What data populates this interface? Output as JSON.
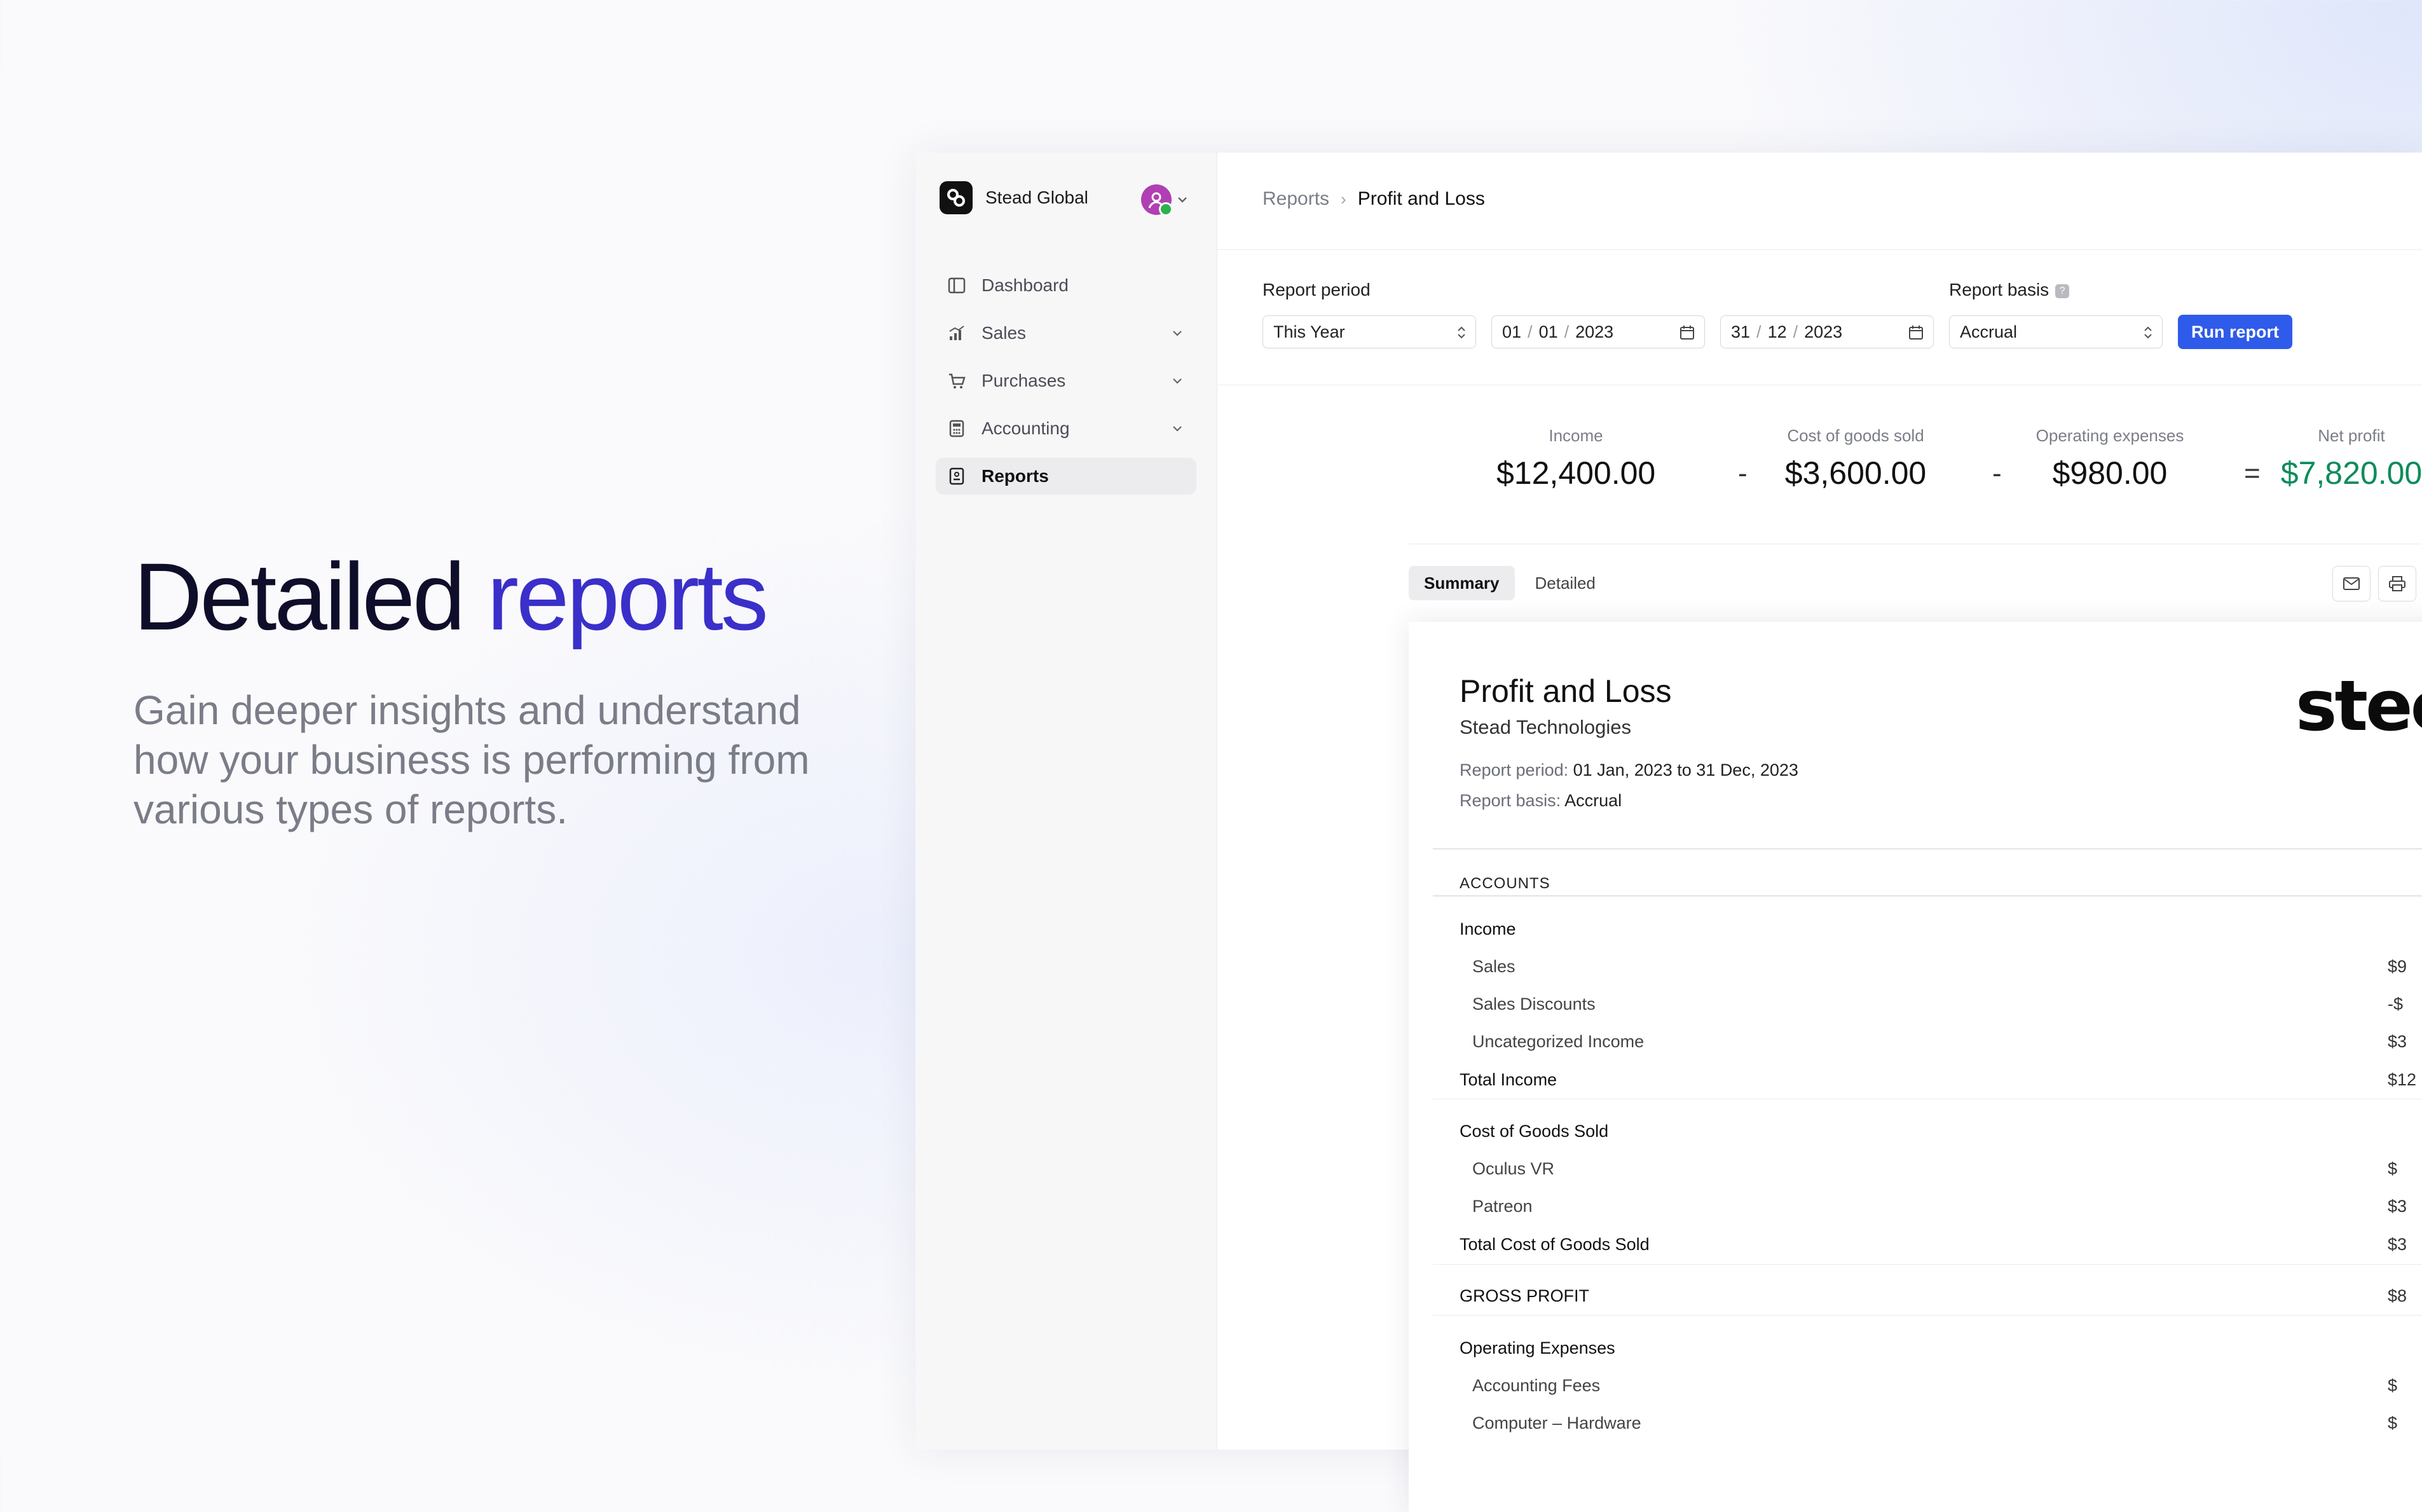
{
  "hero": {
    "title_a": "Detailed",
    "title_b": "reports",
    "subtitle": "Gain deeper insights and understand how your business is performing from various types of reports."
  },
  "org": {
    "name": "Stead Global"
  },
  "nav": [
    {
      "label": "Dashboard",
      "icon": "dashboard-icon"
    },
    {
      "label": "Sales",
      "icon": "sales-chart-icon",
      "expandable": true
    },
    {
      "label": "Purchases",
      "icon": "cart-icon",
      "expandable": true
    },
    {
      "label": "Accounting",
      "icon": "calculator-icon",
      "expandable": true
    },
    {
      "label": "Reports",
      "icon": "report-icon",
      "active": true
    }
  ],
  "breadcrumb": {
    "parent": "Reports",
    "current": "Profit and Loss"
  },
  "filters": {
    "period_label": "Report period",
    "period_value": "This Year",
    "from": {
      "dd": "01",
      "mm": "01",
      "yyyy": "2023"
    },
    "to": {
      "dd": "31",
      "mm": "12",
      "yyyy": "2023"
    },
    "basis_label": "Report basis",
    "basis_value": "Accrual",
    "run_label": "Run report"
  },
  "kpis": {
    "income": {
      "label": "Income",
      "value": "$12,400.00"
    },
    "cogs": {
      "label": "Cost of goods sold",
      "value": "$3,600.00"
    },
    "opex": {
      "label": "Operating expenses",
      "value": "$980.00"
    },
    "net": {
      "label": "Net profit",
      "value": "$7,820.00"
    },
    "op_minus": "-",
    "op_equals": "="
  },
  "tabs": {
    "summary": "Summary",
    "detailed": "Detailed"
  },
  "report": {
    "title": "Profit and Loss",
    "company": "Stead Technologies",
    "period_key": "Report period:",
    "period_val": "01 Jan, 2023 to 31 Dec, 2023",
    "basis_key": "Report basis:",
    "basis_val": "Accrual",
    "brand": "stec",
    "accounts_header": "ACCOUNTS",
    "rows": [
      {
        "name": "Income",
        "amount": "",
        "type": "group"
      },
      {
        "name": "Sales",
        "amount": "$9",
        "type": "sub"
      },
      {
        "name": "Sales Discounts",
        "amount": "-$",
        "type": "sub"
      },
      {
        "name": "Uncategorized Income",
        "amount": "$3",
        "type": "sub"
      },
      {
        "name": "Total Income",
        "amount": "$12",
        "type": "total"
      },
      {
        "name": "Cost of Goods Sold",
        "amount": "",
        "type": "group"
      },
      {
        "name": "Oculus VR",
        "amount": "$",
        "type": "sub"
      },
      {
        "name": "Patreon",
        "amount": "$3",
        "type": "sub"
      },
      {
        "name": "Total Cost of Goods Sold",
        "amount": "$3",
        "type": "total"
      },
      {
        "name": "GROSS PROFIT",
        "amount": "$8",
        "type": "gross"
      },
      {
        "name": "Operating Expenses",
        "amount": "",
        "type": "group"
      },
      {
        "name": "Accounting Fees",
        "amount": "$",
        "type": "sub"
      },
      {
        "name": "Computer – Hardware",
        "amount": "$",
        "type": "sub"
      }
    ]
  },
  "colors": {
    "accent": "#3a2fc9",
    "primary_button": "#2f5bea",
    "positive": "#0e8c5b"
  }
}
